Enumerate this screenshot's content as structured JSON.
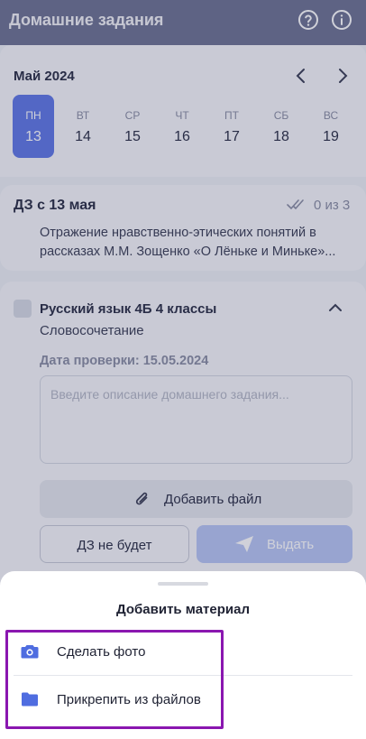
{
  "header": {
    "title": "Домашние задания",
    "help_icon": "help-circle-icon",
    "info_icon": "info-circle-icon"
  },
  "calendar": {
    "month": "Май 2024",
    "days": [
      {
        "name": "ПН",
        "date": "13",
        "selected": true
      },
      {
        "name": "ВТ",
        "date": "14"
      },
      {
        "name": "СР",
        "date": "15"
      },
      {
        "name": "ЧТ",
        "date": "16"
      },
      {
        "name": "ПТ",
        "date": "17"
      },
      {
        "name": "СБ",
        "date": "18"
      },
      {
        "name": "ВС",
        "date": "19"
      }
    ]
  },
  "homework_week": {
    "title": "ДЗ с 13 мая",
    "count": "0 из 3",
    "text_line1": "Отражение нравственно-этических понятий в",
    "text_line2": "рассказах М.М. Зощенко «О Лёньке и Миньке»..."
  },
  "task": {
    "subject": "Русский язык 4Б 4 классы",
    "topic": "Словосочетание",
    "check_date": "Дата проверки: 15.05.2024",
    "description_placeholder": "Введите описание домашнего задания...",
    "add_file_label": "Добавить файл",
    "no_homework_label": "ДЗ не будет",
    "issue_label": "Выдать"
  },
  "sheet": {
    "title": "Добавить материал",
    "options": [
      {
        "label": "Сделать фото",
        "icon": "camera-icon"
      },
      {
        "label": "Прикрепить из файлов",
        "icon": "folder-icon"
      }
    ]
  },
  "colors": {
    "accent": "#5f78e6",
    "header": "#6d7293",
    "highlight": "#8a17b0"
  }
}
